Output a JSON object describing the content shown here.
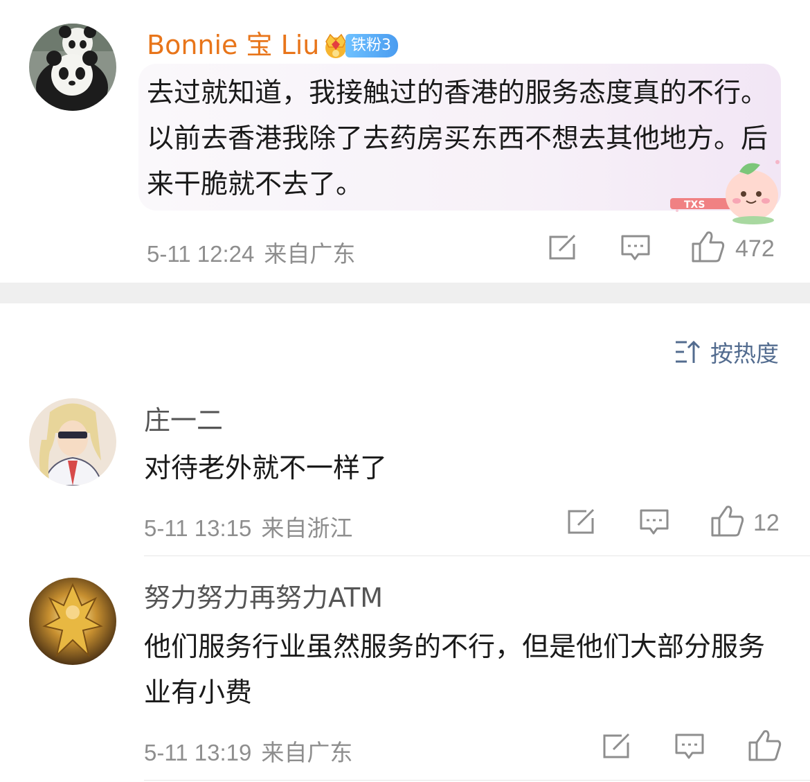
{
  "comments": [
    {
      "username": "Bonnie 宝 Liu",
      "username_color": "#e8751a",
      "badge": "铁粉3",
      "avatar": "panda-avatar",
      "content": "去过就知道，我接触过的香港的服务态度真的不行。以前去香港我除了去药房买东西不想去其他地方。后来干脆就不去了。",
      "time": "5-11 12:24",
      "location": "来自广东",
      "likes": "472"
    },
    {
      "username": "庄一二",
      "avatar": "anime-character-avatar",
      "content": "对待老外就不一样了",
      "time": "5-11 13:15",
      "location": "来自浙江",
      "likes": "12"
    },
    {
      "username": "努力努力再努力ATM",
      "avatar": "golden-warrior-avatar",
      "content": "他们服务行业虽然服务的不行，但是他们大部分服务业有小费",
      "time": "5-11 13:19",
      "location": "来自广东",
      "likes": ""
    }
  ],
  "sort": {
    "label": "按热度"
  },
  "colors": {
    "meta_gray": "#8e8e8e",
    "sort_blue": "#536c8f",
    "separator": "#efefef"
  }
}
